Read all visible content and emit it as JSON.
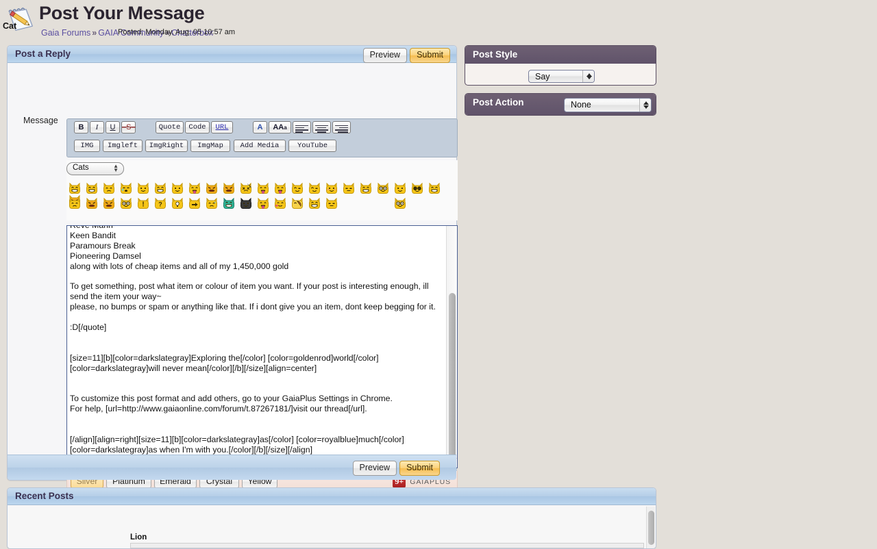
{
  "header": {
    "icon": "notepad-pencil-icon",
    "title": "Post Your Message",
    "breadcrumb": [
      {
        "label": "Gaia Forums"
      },
      {
        "label": "GAIA Community"
      },
      {
        "label": "Chatterbox"
      }
    ],
    "breadcrumb_separator": "»"
  },
  "reply": {
    "panel_title": "Post a Reply",
    "preview_label": "Preview",
    "submit_label": "Submit",
    "message_label": "Message",
    "foot_preview_label": "Preview",
    "foot_submit_label": "Submit"
  },
  "toolbar": {
    "row1": [
      {
        "name": "bold",
        "label": "B",
        "style": "bold"
      },
      {
        "name": "italic",
        "label": "I",
        "style": "italic"
      },
      {
        "name": "underline",
        "label": "U",
        "style": "underline"
      },
      {
        "name": "strikethrough",
        "label": "S",
        "style": "strike"
      },
      {
        "name": "quote",
        "label": "Quote",
        "style": "mono"
      },
      {
        "name": "code",
        "label": "Code",
        "style": "mono"
      },
      {
        "name": "url",
        "label": "URL",
        "style": "url"
      },
      {
        "name": "font-color",
        "label": "A",
        "style": "color"
      },
      {
        "name": "font-size",
        "label": "AAa",
        "style": "size"
      },
      {
        "name": "align-left",
        "label": "",
        "style": "align"
      },
      {
        "name": "align-center",
        "label": "",
        "style": "align"
      },
      {
        "name": "align-right",
        "label": "",
        "style": "align"
      }
    ],
    "row2": [
      {
        "name": "img",
        "label": "IMG"
      },
      {
        "name": "imgleft",
        "label": "Imgleft"
      },
      {
        "name": "imgright",
        "label": "ImgRight"
      },
      {
        "name": "imgmap",
        "label": "ImgMap"
      },
      {
        "name": "add-media",
        "label": "Add Media"
      },
      {
        "name": "youtube",
        "label": "YouTube"
      }
    ]
  },
  "emoticons": {
    "category_selected": "Cats",
    "category_options": [
      "Cats"
    ],
    "row1_count": 23,
    "row2_count": 17,
    "row1": [
      "cat-grin",
      "cat-grin2",
      "cat-worried",
      "cat-cry",
      "cat-smile",
      "cat-laugh",
      "cat-happy",
      "cat-tongue",
      "cat-shout",
      "cat-angry",
      "cat-dizzy",
      "cat-wink-tongue",
      "cat-tongue2",
      "cat-wink",
      "cat-sly",
      "cat-blush",
      "cat-neutral",
      "cat-teeth",
      "cat-glasses",
      "cat-pleased",
      "cat-sunglasses",
      "cat-bigsmile",
      "cat-mad"
    ],
    "row2": [
      "cat-sad",
      "cat-furious",
      "cat-rage",
      "cat-nerd",
      "cat-exclaim",
      "cat-question",
      "cat-idea",
      "cat-arrow",
      "cat-sweat",
      "cat-evilgreen",
      "cat-black",
      "cat-tongueout",
      "cat-heart",
      "cat-pie",
      "cat-laughwink",
      "cat-sleep",
      "cat-spectacles"
    ]
  },
  "message": {
    "value": "Reve Marin\nKeen Bandit\nParamours Break\nPioneering Damsel\nalong with lots of cheap items and all of my 1,450,000 gold\n\nTo get something, post what item or colour of item you want. If your post is interesting enough, ill send the item your way~\nplease, no bumps or spam or anything like that. If i dont give you an item, dont keep begging for it.\n\n:D[/quote]\n\n\n[size=11][b][color=darkslategray]Exploring the[/color] [color=goldenrod]world[/color][color=darkslategray]will never mean[/color][/b][/size][align=center]\n\n\nTo customize this post format and add others, go to your GaiaPlus Settings in Chrome.\nFor help, [url=http://www.gaiaonline.com/forum/t.87267181/]visit our thread[/url].\n\n\n[/align][align=right][size=11][b][color=darkslategray]as[/color] [color=royalblue]much[/color][color=darkslategray]as when I'm with you.[/color][/b][/size][/align]"
  },
  "themes": {
    "buttons": [
      {
        "label": "Silver",
        "active": true
      },
      {
        "label": "Platinum",
        "active": false
      },
      {
        "label": "Emerald",
        "active": false
      },
      {
        "label": "Crystal",
        "active": false
      },
      {
        "label": "Yellow",
        "active": false
      }
    ],
    "brand_badge": "9+",
    "brand_name": "GAIAPLUS"
  },
  "sidebar": {
    "post_style": {
      "title": "Post Style",
      "selected": "Say",
      "options": [
        "Say"
      ]
    },
    "post_action": {
      "title": "Post Action",
      "selected": "None",
      "options": [
        "None"
      ]
    }
  },
  "recent_posts": {
    "title": "Recent Posts",
    "author": "Cat",
    "posted": "Posted: Monday, Aug. 05 10:57 am",
    "quote_author": "Lion"
  },
  "colors": {
    "page_bg": "#e3dfd9",
    "panel_head": "#b6cfe8",
    "dark_head": "#60536a",
    "submit": "#f5bd51",
    "link": "#5b4fa0",
    "textarea_border": "#4a5f93"
  }
}
